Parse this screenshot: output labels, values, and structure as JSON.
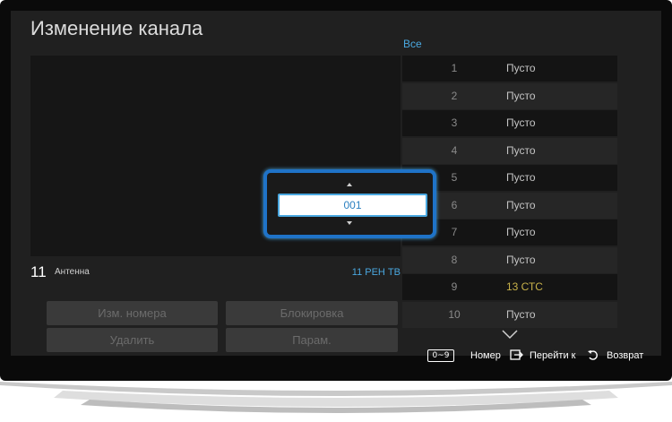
{
  "title": "Изменение канала",
  "current_channel": {
    "number": "11",
    "source": "Антенна",
    "name": "11 РЕН ТВ"
  },
  "buttons": {
    "edit_number": "Изм. номера",
    "lock": "Блокировка",
    "delete": "Удалить",
    "params": "Парам."
  },
  "list": {
    "header": "Все",
    "rows": [
      {
        "num": "1",
        "name": "Пусто"
      },
      {
        "num": "2",
        "name": "Пусто"
      },
      {
        "num": "3",
        "name": "Пусто"
      },
      {
        "num": "4",
        "name": "Пусто"
      },
      {
        "num": "5",
        "name": "Пусто"
      },
      {
        "num": "6",
        "name": "Пусто"
      },
      {
        "num": "7",
        "name": "Пусто"
      },
      {
        "num": "8",
        "name": "Пусто"
      },
      {
        "num": "9",
        "name": "13 СТС"
      },
      {
        "num": "10",
        "name": "Пусто"
      }
    ]
  },
  "number_input": {
    "value": "001"
  },
  "bottom_bar": {
    "key_label": "0~9",
    "number_hint": "Номер",
    "goto_hint": "Перейти к",
    "back_hint": "Возврат"
  },
  "colors": {
    "accent": "#4aa8e0",
    "highlight_channel": "#c8b24a",
    "popup_border": "#1f73c8"
  }
}
